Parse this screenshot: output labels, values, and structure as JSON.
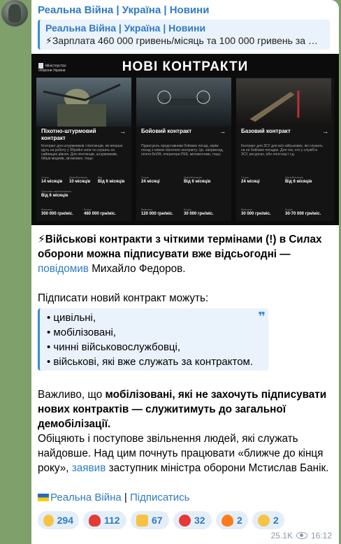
{
  "post": {
    "channel_name": "Реальна Війна | Україна | Новини",
    "reply": {
      "title": "Реальна Війна | Україна | Новини",
      "text": "⚡Зарплата 460 000 гривень/місяць та 100 000 гривень за …"
    },
    "media": {
      "org": "Міністерство оборони України",
      "title": "НОВІ КОНТРАКТИ",
      "cards": [
        {
          "name": "Піхотно-штурмовий контракт",
          "arrow": "→",
          "desc": "Контракт для штурмовиків і піхотинців, які вперше ідуть на роботу у Збройні сили та служать на найвищих рівнях. Для піхотинців, штурмовиків, бійців медиків, зв'язкових, тощо",
          "stats": [
            {
              "label": "Строк",
              "value": "14 місяців"
            },
            {
              "label": "Демобілізація",
              "value": "10 місяців"
            },
            {
              "label": "Грошове забезпечення",
              "value": "Від 6 місяців"
            },
            {
              "label": "Від",
              "value": "Від 6 місяців"
            },
            {
              "label": "Виплата",
              "value": "300 000 грн/міс."
            },
            {
              "label": "Бонус",
              "value": "460 000 грн/міс."
            }
          ]
        },
        {
          "name": "Бойовий контракт",
          "arrow": "→",
          "desc": "Підписують представники бойових посад, окрім посад з новою піхотного контракту. Це, наприклад, пілоти БпЛА, оператори РЕБ, мінометники, тощо.",
          "stats": [
            {
              "label": "Строк",
              "value": "24 місяці"
            },
            {
              "label": "Демобілізація",
              "value": "Від 6 місяців"
            },
            {
              "label": "Виплата",
              "value": "120 000 грн/міс."
            },
            {
              "label": "Бонус",
              "value": "30 000 грн/міс."
            }
          ]
        },
        {
          "name": "Базовий контракт",
          "arrow": "→",
          "desc": "Контракт для ЗСУ для всіх військових, які служать на не бойових посадах. Для тих, хто у службі в ЗСУ, ресурсах, або логістиці і т.д.",
          "stats": [
            {
              "label": "Строк",
              "value": "24 місяці"
            },
            {
              "label": "Демобілізація",
              "value": "Від 6 місяців"
            },
            {
              "label": "Виплата",
              "value": "30 000 грн/міс."
            },
            {
              "label": "Бонус",
              "value": "30-70 000 грн/міс."
            }
          ]
        }
      ]
    },
    "body": {
      "p1_prefix": "⚡Військові контракти з чіткими термінами (!) в Силах оборони можна підписувати вже відсьогодні —",
      "p1_link": "повідомив",
      "p1_suffix": "Михайло Федоров.",
      "p2": "Підписати новий контракт можуть:",
      "quote_items": [
        "• цивільні,",
        "• мобілізовані,",
        "• чинні військовослужбовці,",
        "• військові, які вже служать за контрактом."
      ],
      "quote_icon": "❞",
      "p3_prefix": "Важливо, що ",
      "p3_bold": "мобілізовані, які не захочуть підписувати нових контрактів — служитимуть до загальної демобілізації.",
      "p4_prefix": "Обіцяють і поступове звільнення людей, які служать найдовше. Над цим почнуть працювати «ближче до кінця року»,",
      "p4_link": "заявив",
      "p4_suffix": "заступник міністра оборони Мстислав Банік."
    },
    "footer": {
      "channel_link": "Реальна Війна",
      "separator": "|",
      "subscribe_link": "Підписатись"
    },
    "reactions": [
      {
        "emoji": "grinning-face",
        "count": "294",
        "color": "#f6c343"
      },
      {
        "emoji": "red-heart",
        "count": "112",
        "color": "#e53935"
      },
      {
        "emoji": "thumbs-up",
        "count": "67",
        "color": "#f6c343"
      },
      {
        "emoji": "angry-face",
        "count": "32",
        "color": "#e53935"
      },
      {
        "emoji": "fire",
        "count": "2",
        "color": "#ff7a1a"
      },
      {
        "emoji": "crying-face",
        "count": "2",
        "color": "#f6c343"
      }
    ],
    "views": "25.1K",
    "time": "16:12"
  }
}
